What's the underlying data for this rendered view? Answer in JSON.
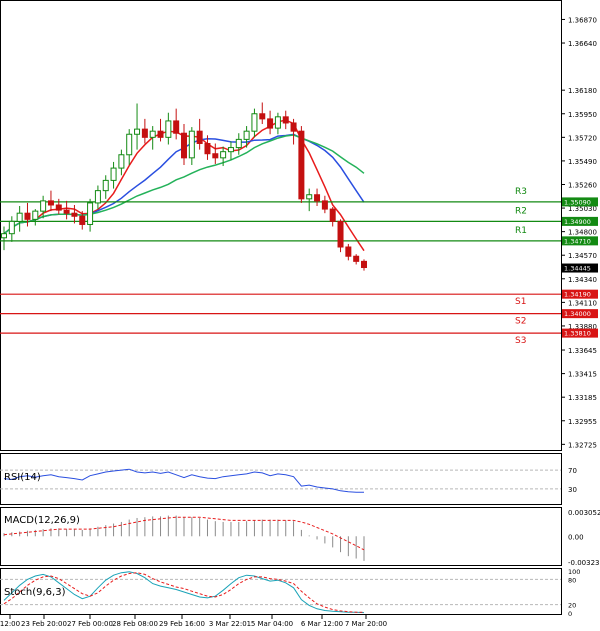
{
  "chart_data": {
    "type": "candlestick",
    "price_axis": {
      "ticks": [
        "1.36870",
        "1.36640",
        "1.36180",
        "1.35950",
        "1.35720",
        "1.35490",
        "1.35260",
        "1.35030",
        "1.34800",
        "1.34570",
        "1.34340",
        "1.34110",
        "1.33880",
        "1.33645",
        "1.33415",
        "1.33185",
        "1.32955",
        "1.32725"
      ],
      "range": [
        1.3266,
        1.3705
      ]
    },
    "x_labels": [
      "12:00",
      "23 Feb 20:00",
      "27 Feb 00:00",
      "28 Feb 08:00",
      "29 Feb 16:00",
      "3 Mar 22:01",
      "5 Mar 04:00",
      "6 Mar 12:00",
      "7 Mar 20:00"
    ],
    "current_price": "1.34445",
    "resistance": [
      {
        "name": "R3",
        "value": 1.3509,
        "label": "1.35090"
      },
      {
        "name": "R2",
        "value": 1.349,
        "label": "1.34900"
      },
      {
        "name": "R1",
        "value": 1.3471,
        "label": "1.34710"
      }
    ],
    "support": [
      {
        "name": "S1",
        "value": 1.3419,
        "label": "1.34190"
      },
      {
        "name": "S2",
        "value": 1.34,
        "label": "1.34000"
      },
      {
        "name": "S3",
        "value": 1.3381,
        "label": "1.33810"
      }
    ],
    "candles": [
      [
        1.3474,
        1.3485,
        1.3462,
        1.3478
      ],
      [
        1.3478,
        1.3495,
        1.347,
        1.349
      ],
      [
        1.349,
        1.3505,
        1.348,
        1.3498
      ],
      [
        1.3498,
        1.3508,
        1.3485,
        1.3492
      ],
      [
        1.3492,
        1.3502,
        1.3486,
        1.35
      ],
      [
        1.35,
        1.3515,
        1.3493,
        1.351
      ],
      [
        1.351,
        1.352,
        1.35,
        1.3506
      ],
      [
        1.3506,
        1.3512,
        1.3497,
        1.3501
      ],
      [
        1.3501,
        1.351,
        1.3492,
        1.3498
      ],
      [
        1.3498,
        1.3506,
        1.3488,
        1.3495
      ],
      [
        1.3495,
        1.35,
        1.3482,
        1.3487
      ],
      [
        1.3487,
        1.3512,
        1.348,
        1.3508
      ],
      [
        1.3508,
        1.3525,
        1.3502,
        1.352
      ],
      [
        1.352,
        1.3535,
        1.3512,
        1.353
      ],
      [
        1.353,
        1.3548,
        1.3522,
        1.3542
      ],
      [
        1.3542,
        1.356,
        1.3535,
        1.3555
      ],
      [
        1.3555,
        1.358,
        1.3545,
        1.3575
      ],
      [
        1.3575,
        1.3605,
        1.356,
        1.358
      ],
      [
        1.358,
        1.359,
        1.3566,
        1.3572
      ],
      [
        1.3572,
        1.3583,
        1.356,
        1.3578
      ],
      [
        1.3578,
        1.359,
        1.3568,
        1.3572
      ],
      [
        1.3572,
        1.3596,
        1.3565,
        1.3588
      ],
      [
        1.3588,
        1.36,
        1.357,
        1.3576
      ],
      [
        1.3576,
        1.3585,
        1.3545,
        1.3552
      ],
      [
        1.3552,
        1.3582,
        1.3545,
        1.3578
      ],
      [
        1.3578,
        1.359,
        1.356,
        1.3566
      ],
      [
        1.3566,
        1.3574,
        1.355,
        1.3556
      ],
      [
        1.3556,
        1.3566,
        1.3546,
        1.3552
      ],
      [
        1.3552,
        1.3563,
        1.3544,
        1.3558
      ],
      [
        1.3558,
        1.3568,
        1.355,
        1.3562
      ],
      [
        1.3562,
        1.3576,
        1.3555,
        1.357
      ],
      [
        1.357,
        1.3583,
        1.3562,
        1.3578
      ],
      [
        1.3578,
        1.36,
        1.3572,
        1.3595
      ],
      [
        1.3595,
        1.3606,
        1.3585,
        1.359
      ],
      [
        1.359,
        1.3598,
        1.3575,
        1.3581
      ],
      [
        1.3581,
        1.3596,
        1.3575,
        1.3592
      ],
      [
        1.3592,
        1.3598,
        1.358,
        1.3586
      ],
      [
        1.3586,
        1.359,
        1.3565,
        1.3578
      ],
      [
        1.3578,
        1.3583,
        1.3508,
        1.3512
      ],
      [
        1.3512,
        1.3522,
        1.35,
        1.3516
      ],
      [
        1.3516,
        1.3522,
        1.3505,
        1.351
      ],
      [
        1.351,
        1.3515,
        1.3498,
        1.3502
      ],
      [
        1.3502,
        1.3504,
        1.3485,
        1.349
      ],
      [
        1.349,
        1.3492,
        1.346,
        1.3465
      ],
      [
        1.3465,
        1.3468,
        1.3452,
        1.3456
      ],
      [
        1.3456,
        1.3458,
        1.3448,
        1.3451
      ],
      [
        1.3451,
        1.3453,
        1.3442,
        1.3445
      ]
    ],
    "indicators": {
      "rsi": {
        "label": "RSI(14)",
        "ticks": [
          "70",
          "30"
        ],
        "levels": [
          70,
          30
        ],
        "values": [
          52,
          50,
          56,
          58,
          55,
          58,
          60,
          56,
          54,
          52,
          49,
          58,
          62,
          66,
          68,
          70,
          72,
          66,
          64,
          66,
          63,
          66,
          60,
          54,
          60,
          56,
          53,
          52,
          56,
          58,
          60,
          62,
          66,
          64,
          58,
          62,
          60,
          56,
          36,
          38,
          34,
          32,
          30,
          26,
          24,
          23,
          23
        ]
      },
      "macd": {
        "label": "MACD(12,26,9)",
        "ticks": [
          "0.003052",
          "0.00",
          "-0.003236"
        ],
        "hist": [
          0.0004,
          0.0005,
          0.0006,
          0.0007,
          0.0008,
          0.0009,
          0.001,
          0.001,
          0.0009,
          0.0009,
          0.0008,
          0.001,
          0.0012,
          0.0014,
          0.0016,
          0.0018,
          0.0021,
          0.0023,
          0.0024,
          0.0025,
          0.0025,
          0.0026,
          0.0026,
          0.0024,
          0.0024,
          0.0023,
          0.0021,
          0.0019,
          0.0018,
          0.0018,
          0.0018,
          0.0019,
          0.002,
          0.0021,
          0.0021,
          0.0021,
          0.002,
          0.0019,
          0.0008,
          0.0001,
          -0.0004,
          -0.0009,
          -0.0014,
          -0.002,
          -0.0025,
          -0.0028,
          -0.0031
        ],
        "signal": [
          0.0002,
          0.0003,
          0.0004,
          0.0005,
          0.0006,
          0.0007,
          0.0008,
          0.0009,
          0.0009,
          0.0009,
          0.0009,
          0.0009,
          0.001,
          0.0011,
          0.0012,
          0.0014,
          0.0016,
          0.0018,
          0.002,
          0.0021,
          0.0022,
          0.0023,
          0.0024,
          0.0024,
          0.0024,
          0.0024,
          0.0023,
          0.0022,
          0.0021,
          0.002,
          0.002,
          0.002,
          0.002,
          0.002,
          0.002,
          0.002,
          0.002,
          0.002,
          0.0018,
          0.0015,
          0.0011,
          0.0007,
          0.0003,
          -0.0002,
          -0.0007,
          -0.0012,
          -0.0017
        ]
      },
      "stoch": {
        "label": "Stoch(9,6,3)",
        "ticks": [
          "100",
          "80",
          "20",
          "0"
        ],
        "main": [
          30,
          48,
          66,
          80,
          88,
          92,
          86,
          72,
          58,
          44,
          34,
          40,
          60,
          78,
          90,
          96,
          98,
          94,
          84,
          70,
          64,
          60,
          56,
          50,
          44,
          38,
          36,
          40,
          54,
          70,
          84,
          90,
          88,
          82,
          76,
          78,
          72,
          60,
          32,
          18,
          10,
          6,
          4,
          3,
          2,
          2,
          1
        ],
        "signal": [
          22,
          34,
          50,
          66,
          78,
          86,
          88,
          82,
          70,
          58,
          46,
          40,
          48,
          64,
          78,
          88,
          94,
          96,
          92,
          82,
          74,
          68,
          62,
          58,
          52,
          46,
          40,
          38,
          44,
          56,
          70,
          80,
          86,
          86,
          82,
          80,
          76,
          70,
          52,
          36,
          22,
          14,
          8,
          5,
          3,
          2,
          2
        ]
      }
    }
  }
}
